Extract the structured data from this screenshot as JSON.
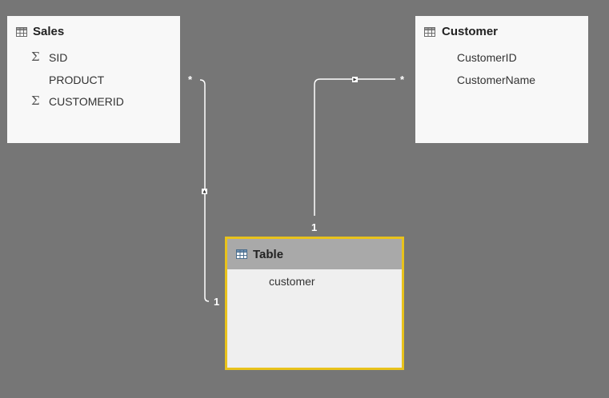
{
  "tables": {
    "sales": {
      "title": "Sales",
      "icon": "table-icon",
      "fields": [
        {
          "name": "SID",
          "icon": "sigma-icon"
        },
        {
          "name": "PRODUCT",
          "icon": ""
        },
        {
          "name": "CUSTOMERID",
          "icon": "sigma-icon"
        }
      ]
    },
    "customer": {
      "title": "Customer",
      "icon": "table-icon",
      "fields": [
        {
          "name": "CustomerID"
        },
        {
          "name": "CustomerName"
        }
      ]
    },
    "table": {
      "title": "Table",
      "icon": "table-icon",
      "selected": true,
      "fields": [
        {
          "name": "customer"
        }
      ]
    }
  },
  "relationships": {
    "sales_to_table": {
      "from_cardinality": "*",
      "to_cardinality": "1"
    },
    "customer_to_table": {
      "from_cardinality": "*",
      "to_cardinality": "1"
    }
  },
  "colors": {
    "canvas": "#767676",
    "card": "#f8f8f8",
    "selected_border": "#e8c21c",
    "selected_header": "#a9a9a9",
    "line": "#ffffff"
  }
}
